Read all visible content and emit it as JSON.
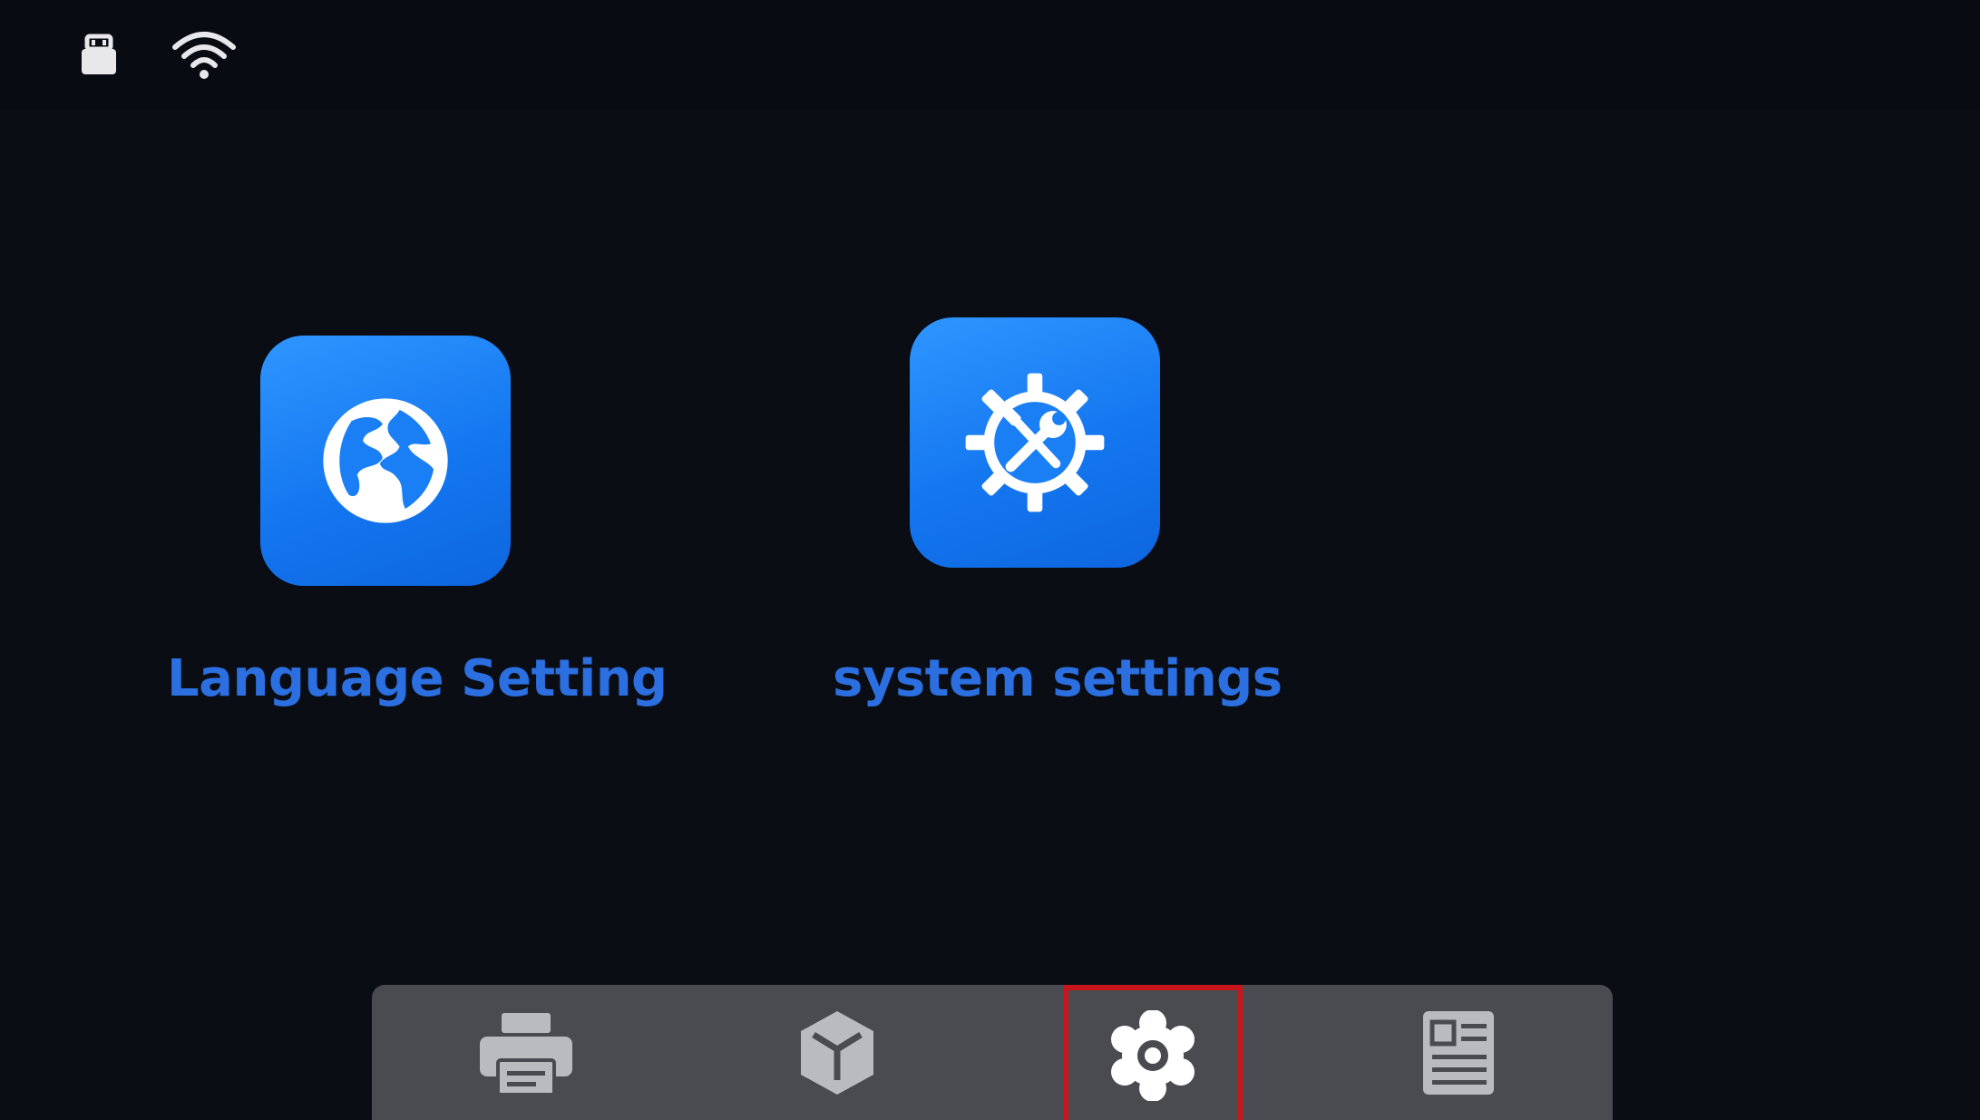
{
  "status_bar": {
    "icons": [
      "usb-drive-icon",
      "wifi-icon"
    ]
  },
  "apps": [
    {
      "label": "Language Setting",
      "icon": "globe-icon"
    },
    {
      "label": "system settings",
      "icon": "tools-gear-icon"
    }
  ],
  "nav": {
    "items": [
      {
        "icon": "printer-icon",
        "active": false
      },
      {
        "icon": "cube-icon",
        "active": false
      },
      {
        "icon": "gear-icon",
        "active": true
      },
      {
        "icon": "info-card-icon",
        "active": false
      }
    ]
  },
  "colors": {
    "background": "#0b0d15",
    "tile_blue": "#1a7ff5",
    "label_blue": "#2b6fe0",
    "nav_bar": "#4a4b51",
    "nav_icon": "#b9bbbf",
    "active_highlight": "#c8151b"
  }
}
